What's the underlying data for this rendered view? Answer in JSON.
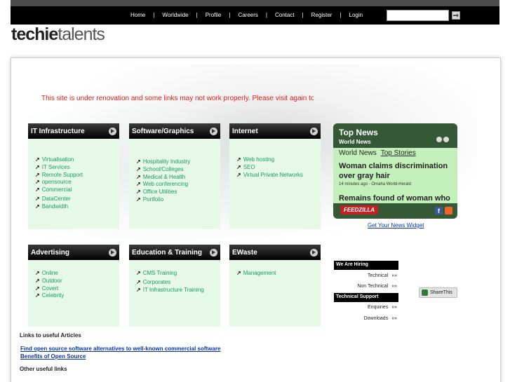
{
  "topnav": {
    "links": [
      "Home",
      "Worldwide",
      "Profile",
      "Careers",
      "Contact",
      "Register",
      "Login"
    ],
    "separator": "|",
    "search_value": ""
  },
  "logo": {
    "bold": "techie",
    "light": "talents"
  },
  "notice": "This site is under renovation and some links may not work properly. Please visit again to",
  "boxes": {
    "it": {
      "title": "IT Infrastructure",
      "items": [
        "Virtualisation",
        "IT Services",
        "Remote Support",
        "opensource",
        "Commercial",
        "DataCenter",
        "Bandwidth"
      ]
    },
    "software": {
      "title": "Software/Graphics",
      "items": [
        "Hospitality Industry",
        "School/Colleges",
        "Medical & Health",
        "Web conferencing",
        "Office Utilities",
        "Portfolio"
      ]
    },
    "internet": {
      "title": "Internet",
      "items": [
        "Web hosting",
        "SEO",
        "Virtual Private Networks"
      ]
    },
    "advertising": {
      "title": "Advertising",
      "items": [
        "Online",
        "Outdoor",
        "Covert",
        "Celebrity"
      ]
    },
    "education": {
      "title": "Education & Training",
      "items": [
        "CMS Training",
        "Corporates",
        "IT Infrastructure Training"
      ]
    },
    "ewaste": {
      "title": "EWaste",
      "items": [
        "Management"
      ]
    }
  },
  "news": {
    "title": "Top News",
    "subtitle": "World News",
    "tab_world": "World News",
    "tab_top": "Top Stories",
    "headline": "Woman claims discrimination over gray hair",
    "meta": "14 minutes ago - Omaha World-Herald",
    "headline2": "Remains found of woman who",
    "brand": "FEEDZILLA",
    "fb": "f",
    "widget_link": "Get Your News Widget"
  },
  "hiring": {
    "header1": "We Are Hiring",
    "items1": [
      "Technical",
      "Non Technical"
    ],
    "header2": "Technical Support",
    "items2": [
      "Enquiries",
      "Downloads"
    ],
    "arrow": "»»"
  },
  "share": "ShareThis",
  "articles": {
    "heading": "Links to useful Articles",
    "links": [
      "Find open source software alternatives to well-known commercial software",
      "Benefits of Open Source"
    ],
    "other_heading": "Other useful links"
  },
  "colors": {
    "green_link": "#1a9a63",
    "box_bg": "#e6f9e6",
    "notice_red": "#e0201b",
    "news_green": "#355937"
  }
}
